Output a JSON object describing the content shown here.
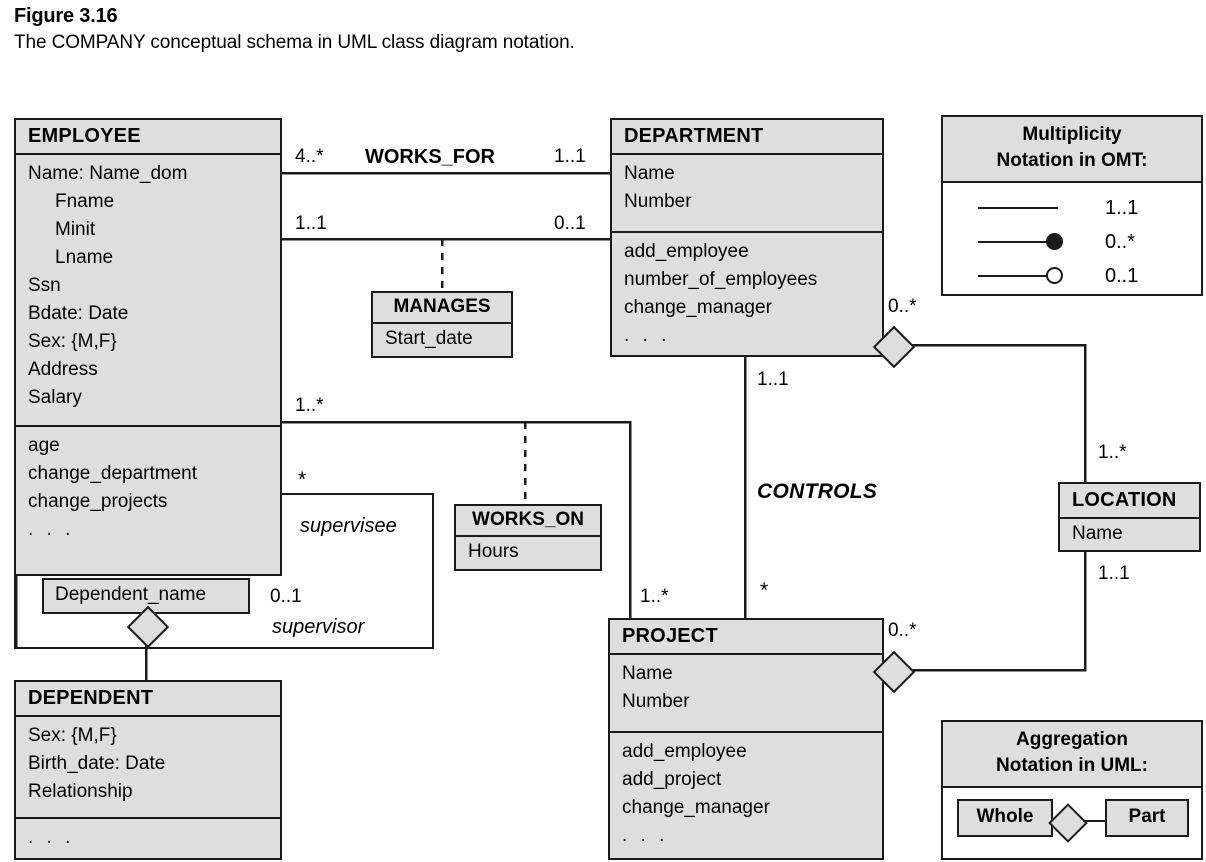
{
  "figure": {
    "number": "Figure 3.16",
    "caption": "The COMPANY conceptual schema in UML class diagram notation."
  },
  "colors": {
    "class_fill": "#dedede",
    "stroke": "#1a1a1a",
    "page_bg": "#ffffff"
  },
  "classes": {
    "employee": {
      "name": "EMPLOYEE",
      "attributes": [
        "Name: Name_dom",
        "Fname",
        "Minit",
        "Lname",
        "Ssn",
        "Bdate: Date",
        "Sex: {M,F}",
        "Address",
        "Salary"
      ],
      "operations": [
        "age",
        "change_department",
        "change_projects",
        ". . ."
      ]
    },
    "department": {
      "name": "DEPARTMENT",
      "attributes": [
        "Name",
        "Number"
      ],
      "operations": [
        "add_employee",
        "number_of_employees",
        "change_manager",
        ". . ."
      ]
    },
    "project": {
      "name": "PROJECT",
      "attributes": [
        "Name",
        "Number"
      ],
      "operations": [
        "add_employee",
        "add_project",
        "change_manager",
        ". . ."
      ]
    },
    "dependent": {
      "name": "DEPENDENT",
      "attributes": [
        "Sex: {M,F}",
        "Birth_date: Date",
        "Relationship"
      ],
      "operations": [
        ". . ."
      ]
    },
    "location": {
      "name": "LOCATION",
      "attributes": [
        "Name"
      ]
    }
  },
  "association_classes": {
    "manages": {
      "name": "MANAGES",
      "attribute": "Start_date"
    },
    "works_on": {
      "name": "WORKS_ON",
      "attribute": "Hours"
    }
  },
  "attribute_boxes": {
    "dependent_name": "Dependent_name"
  },
  "association_names": {
    "works_for": "WORKS_FOR",
    "controls": "CONTROLS"
  },
  "roles": {
    "supervisee": "supervisee",
    "supervisor": "supervisor"
  },
  "multiplicities": {
    "works_for_employee": "4..*",
    "works_for_department": "1..1",
    "manages_employee": "1..1",
    "manages_department": "0..1",
    "works_on_employee": "1..*",
    "works_on_project": "1..*",
    "supervision_supervisee": "*",
    "supervision_supervisor": "0..1",
    "controls_department": "1..1",
    "controls_project": "*",
    "dept_location_dept": "0..*",
    "dept_location_loc": "1..*",
    "proj_location_proj": "0..*",
    "proj_location_loc": "1..1"
  },
  "legend_multiplicity": {
    "title_line1": "Multiplicity",
    "title_line2": "Notation in OMT:",
    "rows": [
      {
        "glyph": "plain-line",
        "label": "1..1"
      },
      {
        "glyph": "filled-circle-line",
        "label": "0..*"
      },
      {
        "glyph": "open-circle-line",
        "label": "0..1"
      }
    ]
  },
  "legend_aggregation": {
    "title_line1": "Aggregation",
    "title_line2": "Notation in UML:",
    "whole_label": "Whole",
    "part_label": "Part",
    "diamond_icon": "aggregation-diamond-icon"
  }
}
